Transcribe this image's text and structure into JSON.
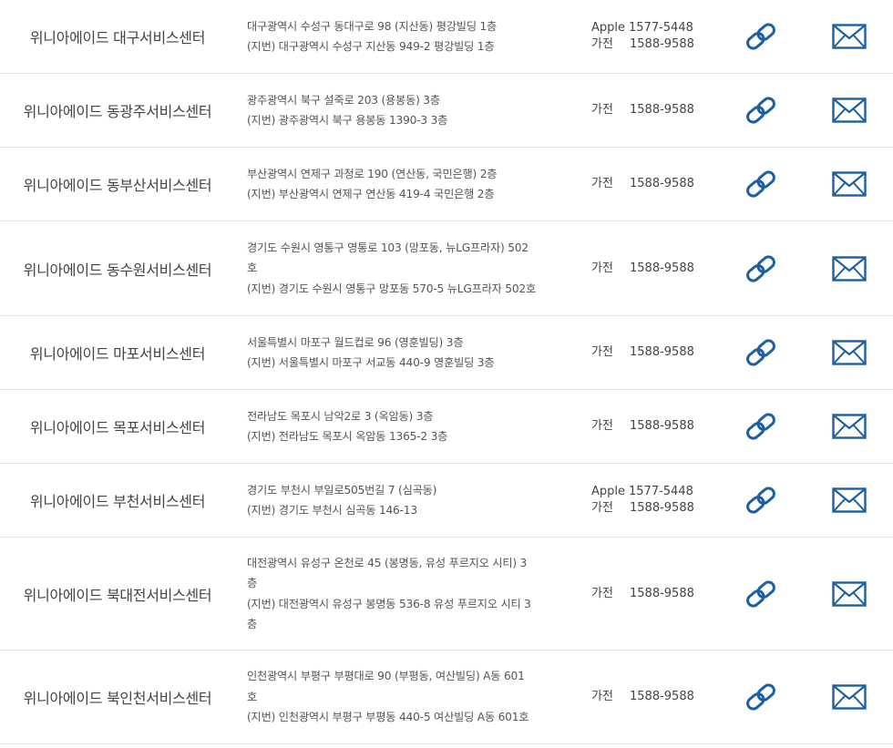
{
  "colors": {
    "icon": "#1d5fa3",
    "divider": "#e2e2e2",
    "text": "#444444"
  },
  "icons": {
    "link": "link-icon",
    "mail": "mail-icon"
  },
  "centers": [
    {
      "name": "위니아에이드 대구서비스센터",
      "address": [
        "대구광역시 수성구 동대구로 98 (지산동) 평강빌딩 1층",
        "(지번) 대구광역시 수성구 지산동 949-2 평강빌딩 1층"
      ],
      "apple": {
        "label": "Apple",
        "number": "1577-5448"
      },
      "appliance": {
        "label": "가전",
        "number": "1588-9588"
      }
    },
    {
      "name": "위니아에이드 동광주서비스센터",
      "address": [
        "광주광역시 북구 설죽로 203 (용봉동) 3층",
        "(지번) 광주광역시 북구 용봉동 1390-3 3층"
      ],
      "appliance": {
        "label": "가전",
        "number": "1588-9588"
      }
    },
    {
      "name": "위니아에이드 동부산서비스센터",
      "address": [
        "부산광역시 연제구 과정로 190 (연산동, 국민은행) 2층",
        "(지번) 부산광역시 연제구 연산동 419-4 국민은행 2층"
      ],
      "appliance": {
        "label": "가전",
        "number": "1588-9588"
      }
    },
    {
      "name": "위니아에이드 동수원서비스센터",
      "address": [
        "경기도 수원시 영통구 영통로 103 (망포동, 뉴LG프라자) 502",
        "호",
        "(지번) 경기도 수원시 영통구 망포동 570-5 뉴LG프라자 502호"
      ],
      "appliance": {
        "label": "가전",
        "number": "1588-9588"
      }
    },
    {
      "name": "위니아에이드 마포서비스센터",
      "address": [
        "서울특별시 마포구 월드컵로 96 (영훈빌딩) 3층",
        "(지번) 서울특별시 마포구 서교동 440-9 영훈빌딩 3층"
      ],
      "appliance": {
        "label": "가전",
        "number": "1588-9588"
      }
    },
    {
      "name": "위니아에이드 목포서비스센터",
      "address": [
        "전라남도 목포시 남악2로 3 (옥암동) 3층",
        "(지번) 전라남도 목포시 옥암동 1365-2 3층"
      ],
      "appliance": {
        "label": "가전",
        "number": "1588-9588"
      }
    },
    {
      "name": "위니아에이드 부천서비스센터",
      "address": [
        "경기도 부천시 부일로505번길 7 (심곡동)",
        "(지번) 경기도 부천시 심곡동 146-13"
      ],
      "apple": {
        "label": "Apple",
        "number": "1577-5448"
      },
      "appliance": {
        "label": "가전",
        "number": "1588-9588"
      }
    },
    {
      "name": "위니아에이드 북대전서비스센터",
      "address": [
        "대전광역시 유성구 온천로 45 (봉명동, 유성 푸르지오 시티) 3",
        "층",
        "(지번) 대전광역시 유성구 봉명동 536-8 유성 푸르지오 시티 3",
        "층"
      ],
      "appliance": {
        "label": "가전",
        "number": "1588-9588"
      }
    },
    {
      "name": "위니아에이드 북인천서비스센터",
      "address": [
        "인천광역시 부평구 부평대로 90 (부평동, 여산빌딩) A동 601",
        "호",
        "(지번) 인천광역시 부평구 부평동 440-5 여산빌딩 A동 601호"
      ],
      "appliance": {
        "label": "가전",
        "number": "1588-9588"
      }
    }
  ]
}
